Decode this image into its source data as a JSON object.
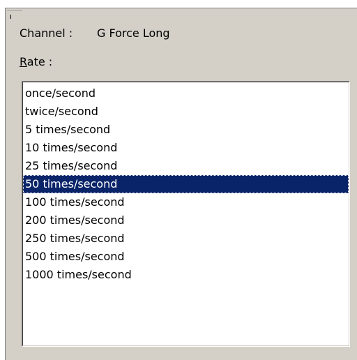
{
  "channel": {
    "label": "Channel :",
    "value": "G Force Long"
  },
  "rate": {
    "label_accel": "R",
    "label_rest": "ate :"
  },
  "rate_list": {
    "items": [
      "once/second",
      "twice/second",
      "5 times/second",
      "10 times/second",
      "25 times/second",
      "50 times/second",
      "100 times/second",
      "200 times/second",
      "250 times/second",
      "500 times/second",
      "1000 times/second"
    ],
    "selected": "50 times/second"
  },
  "colors": {
    "dialog_bg": "#d4d0c8",
    "selection_bg": "#0a246a",
    "selection_fg": "#ffffff"
  }
}
